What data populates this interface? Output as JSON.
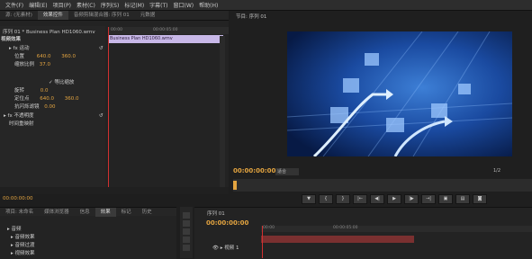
{
  "menu": [
    "文件(F)",
    "编辑(E)",
    "项目(P)",
    "素材(C)",
    "序列(S)",
    "标记(M)",
    "字幕(T)",
    "窗口(W)",
    "帮助(H)"
  ],
  "left_tabs": [
    "源: (无素材)",
    "效果控件",
    "音频剪辑混合器: 序列 01",
    "元数据"
  ],
  "effect_controls": {
    "clip_title": "序列 01 * Business Plan HD1060.wmv",
    "clip_bar_label": "Business Plan HD1060.wmv",
    "ruler_left": "00:00",
    "ruler_mid": "00:00:05:00",
    "section_video": "视频效果",
    "motion": "运动",
    "position_label": "位置",
    "position_x": "640.0",
    "position_y": "360.0",
    "scale_label": "缩放比例",
    "scale_value": "37.0",
    "uniform_scale": "等比缩放",
    "rotation_label": "旋转",
    "rotation_value": "0.0",
    "anchor_label": "定位点",
    "anchor_x": "640.0",
    "anchor_y": "360.0",
    "flicker_label": "抗闪烁滤镜",
    "flicker_value": "0.00",
    "opacity": "不透明度",
    "time_remap": "时间重映射",
    "timecode": "00:00:00:00"
  },
  "program": {
    "tab": "节目: 序列 01",
    "timecode": "00:00:00:00",
    "fit": "适合",
    "ratio": "1/2",
    "controls": [
      "▼",
      "{",
      "}",
      "|←",
      "◀|",
      "▶",
      "|▶",
      "→|",
      "▣",
      "▤",
      "◙"
    ]
  },
  "project": {
    "tabs": [
      "项目: 未命名",
      "媒体浏览器",
      "信息",
      "效果",
      "标记",
      "历史"
    ],
    "items": [
      "音频",
      "音频效果",
      "音频过渡",
      "视频效果"
    ]
  },
  "timeline": {
    "title": "序列 01",
    "timecode": "00:00:00:00",
    "ruler_left": "00:00",
    "ruler_mid": "00:00:05:00",
    "track": "视频 1"
  },
  "colors": {
    "accent": "#e3a440",
    "clip": "#c8b8e8",
    "playhead": "#d03030"
  }
}
